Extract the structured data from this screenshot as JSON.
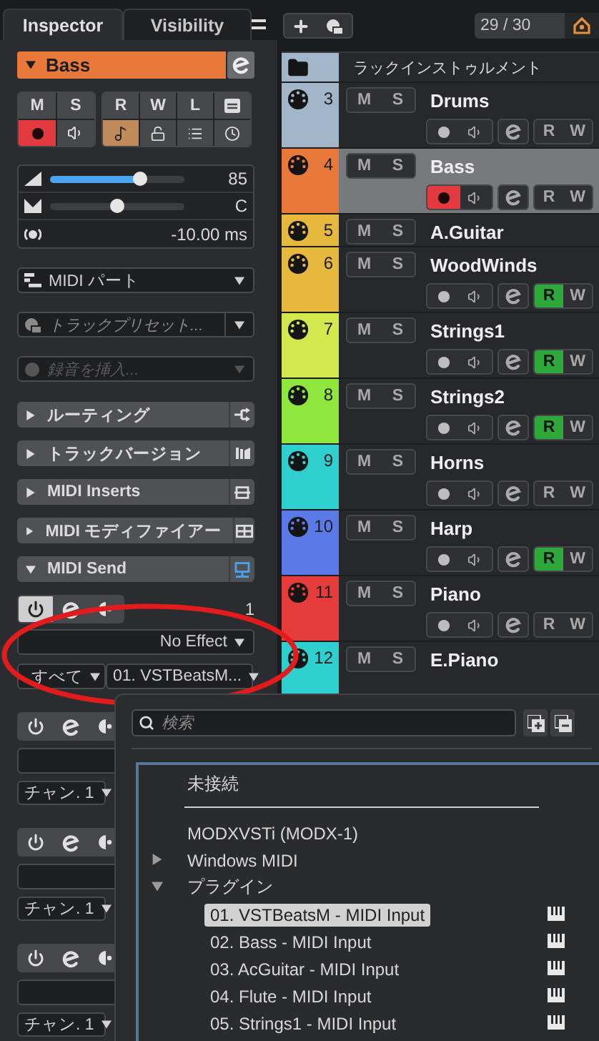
{
  "inspector": {
    "tabs": [
      {
        "label": "Inspector",
        "selected": true
      },
      {
        "label": "Visibility",
        "selected": false
      }
    ],
    "track": {
      "name": "Bass",
      "expanded": true
    },
    "controls": {
      "mute": "M",
      "solo": "S",
      "read": "R",
      "write": "W",
      "lanes": "L",
      "record": true,
      "monitor": false,
      "musical_time": true
    },
    "volume": {
      "level": 0.67,
      "reading": "85"
    },
    "pan": {
      "level": 0.5,
      "reading": "C"
    },
    "delay": {
      "reading": "-10.00 ms"
    },
    "midi_part": "MIDI パート",
    "track_preset": {
      "placeholder": "トラックプリセット..."
    },
    "insert_recording": {
      "placeholder": "録音を挿入...",
      "disabled": true
    },
    "sections": [
      {
        "label": "ルーティング",
        "expanded": false
      },
      {
        "label": "トラックバージョン",
        "expanded": false
      },
      {
        "label": "MIDI Inserts",
        "expanded": false
      },
      {
        "label": "MIDI モディファイアー",
        "expanded": false
      },
      {
        "label": "MIDI Send",
        "expanded": true
      }
    ],
    "send": {
      "on": true,
      "number": "1",
      "effect": "No Effect",
      "channel": "すべて",
      "output": "01. VSTBeatsM..."
    },
    "more_sends": [
      {
        "on": false,
        "channel": "チャン. 1"
      },
      {
        "on": false,
        "channel": "チャン. 1"
      },
      {
        "on": false,
        "channel": "チャン. 1"
      }
    ]
  },
  "track_list": {
    "counter": "29 / 30",
    "folder": {
      "name": "ラックインストゥルメント",
      "color": "#a3b5c9"
    },
    "tracks": [
      {
        "number": "3",
        "name": "Drums",
        "color": "#a3b5c9",
        "selected": false,
        "mute": "M",
        "solo": "S",
        "expanded": true,
        "record": false,
        "read": false,
        "read_label": "R",
        "write_label": "W"
      },
      {
        "number": "4",
        "name": "Bass",
        "color": "#e8793a",
        "selected": true,
        "mute": "M",
        "solo": "S",
        "expanded": true,
        "record": true,
        "read": false,
        "read_label": "R",
        "write_label": "W"
      },
      {
        "number": "5",
        "name": "A.Guitar",
        "color": "#e6b93e",
        "selected": false,
        "mute": "M",
        "solo": "S",
        "expanded": false
      },
      {
        "number": "6",
        "name": "WoodWinds",
        "color": "#e6b93e",
        "selected": false,
        "mute": "M",
        "solo": "S",
        "expanded": true,
        "record": false,
        "read": true,
        "read_label": "R",
        "write_label": "W"
      },
      {
        "number": "7",
        "name": "Strings1",
        "color": "#d3e84c",
        "selected": false,
        "mute": "M",
        "solo": "S",
        "expanded": true,
        "record": false,
        "read": true,
        "read_label": "R",
        "write_label": "W"
      },
      {
        "number": "8",
        "name": "Strings2",
        "color": "#8fe63c",
        "selected": false,
        "mute": "M",
        "solo": "S",
        "expanded": true,
        "record": false,
        "read": true,
        "read_label": "R",
        "write_label": "W"
      },
      {
        "number": "9",
        "name": "Horns",
        "color": "#2fcfcf",
        "selected": false,
        "mute": "M",
        "solo": "S",
        "expanded": true,
        "record": false,
        "read": false,
        "read_label": "R",
        "write_label": "W"
      },
      {
        "number": "10",
        "name": "Harp",
        "color": "#5b7ae8",
        "selected": false,
        "mute": "M",
        "solo": "S",
        "expanded": true,
        "record": false,
        "read": true,
        "read_label": "R",
        "write_label": "W"
      },
      {
        "number": "11",
        "name": "Piano",
        "color": "#e63b3b",
        "selected": false,
        "mute": "M",
        "solo": "S",
        "expanded": true,
        "record": false,
        "read": false,
        "read_label": "R",
        "write_label": "W"
      },
      {
        "number": "12",
        "name": "E.Piano",
        "color": "#2fcfcf",
        "selected": false,
        "mute": "M",
        "solo": "S",
        "expanded": true
      }
    ]
  },
  "output_menu": {
    "search": {
      "placeholder": "検索"
    },
    "none_option": "未接続",
    "entries": [
      {
        "label": "MODXVSTi (MODX-1)"
      },
      {
        "label": "Windows MIDI",
        "expanded": false
      },
      {
        "label": "プラグイン",
        "expanded": true,
        "children": [
          {
            "label": "01. VSTBeatsM - MIDI Input",
            "selected": true
          },
          {
            "label": "02. Bass - MIDI Input",
            "selected": false
          },
          {
            "label": "03. AcGuitar - MIDI Input",
            "selected": false
          },
          {
            "label": "04. Flute - MIDI Input",
            "selected": false
          },
          {
            "label": "05. Strings1 - MIDI Input",
            "selected": false
          }
        ]
      }
    ]
  }
}
